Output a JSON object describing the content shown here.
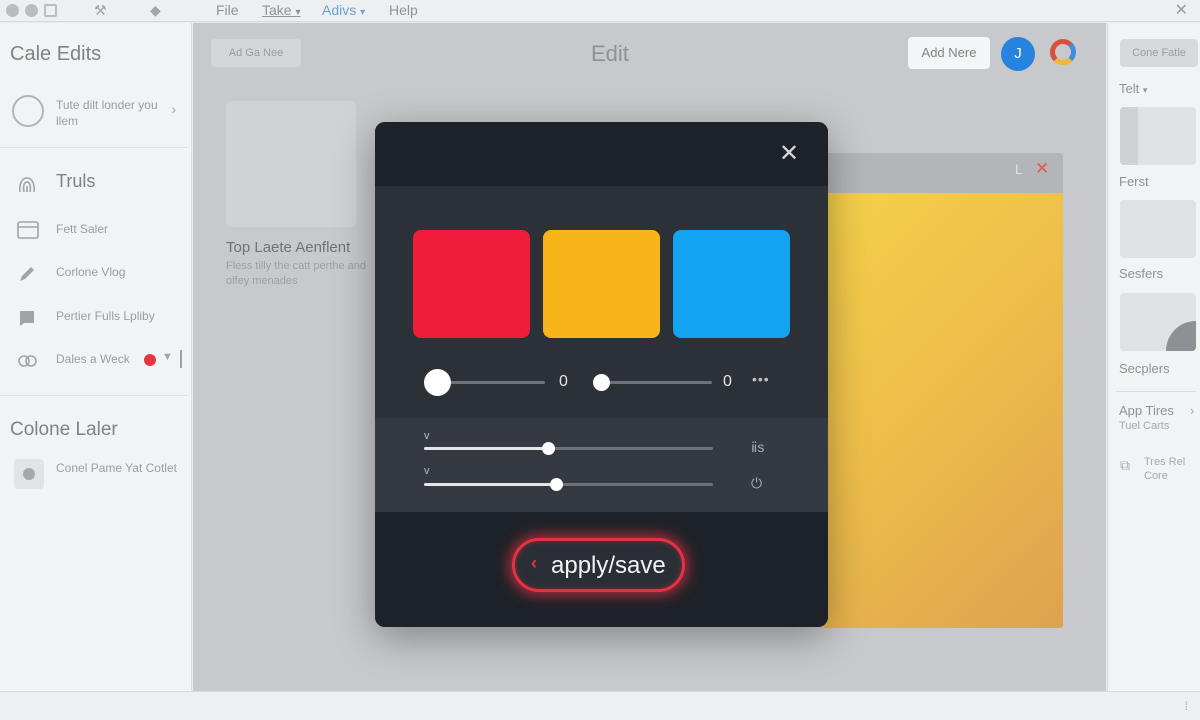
{
  "menubar": {
    "items": [
      {
        "label": "File"
      },
      {
        "label": "Take",
        "caret": "▾"
      },
      {
        "label": "Adivs",
        "caret": "▾"
      },
      {
        "label": "Help"
      }
    ],
    "close_glyph": "✕"
  },
  "left_sidebar": {
    "title": "Cale Edits",
    "card": {
      "text": "Tute dilt londer you llem",
      "chevron": "›"
    },
    "nav": [
      {
        "label": "Truls",
        "icon": "fingerprint-icon"
      },
      {
        "label": "Fett Saler",
        "icon": "window-icon"
      },
      {
        "label": "Corlone Vlog",
        "icon": "pencil-icon"
      },
      {
        "label": "Pertier Fulls Lpliby",
        "icon": "flag-icon"
      },
      {
        "label": "Dales a Weck",
        "icon": "link-icon",
        "status_color": "#e8343f"
      }
    ],
    "section2_title": "Colone Laler",
    "bottom_item": {
      "text": "Conel Pame Yat Cotlet"
    }
  },
  "center": {
    "top_pill": "Ad Ga Nee",
    "title": "Edit",
    "add_button": "Add Nere",
    "avatar_label": "J",
    "card_title": "Top Laete Aenflent",
    "card_subtitle": "Fless tilly the catt perthe and olfey menades",
    "panel_glyphs": {
      "l": "L",
      "x": "✕"
    }
  },
  "right_sidebar": {
    "top_button": "Cone Fatle",
    "filter_label": "Telt",
    "filter_caret": "▾",
    "labels": [
      "Ferst",
      "Sesfers",
      "Secplers"
    ],
    "app_title": "App Tires",
    "app_sub": "Tuel Carts",
    "app_chevron": "›",
    "tree_text": "Tres Rel Core"
  },
  "statusbar": {
    "right_glyph": "⁞"
  },
  "modal": {
    "close_glyph": "✕",
    "swatches": [
      {
        "name": "red",
        "color": "#ef1c3c"
      },
      {
        "name": "amber",
        "color": "#f7b519"
      },
      {
        "name": "blue",
        "color": "#14a3f0"
      }
    ],
    "slider_a": {
      "value": "0",
      "level": 0
    },
    "slider_b": {
      "value": "0",
      "level": 0
    },
    "more_glyph": "•••",
    "slider_c": {
      "tick": "v",
      "level": 0.43,
      "icon": "ⅱs"
    },
    "slider_d": {
      "tick": "v",
      "level": 0.46,
      "icon": "⏻"
    },
    "apply_button": {
      "label": "apply/save",
      "icon_glyph": "‹",
      "glow_color": "#e53242"
    }
  }
}
